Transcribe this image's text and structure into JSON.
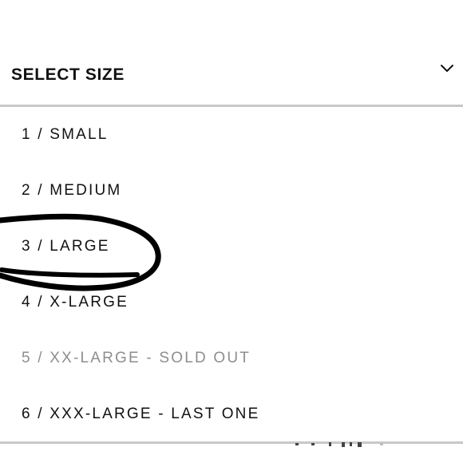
{
  "size_selector": {
    "title": "SELECT SIZE",
    "toggle_icon": "chevron-down-icon",
    "options": [
      {
        "label": "1 / SMALL",
        "available": true
      },
      {
        "label": "2 / MEDIUM",
        "available": true
      },
      {
        "label": "3 / LARGE",
        "available": true
      },
      {
        "label": "4 / X-LARGE",
        "available": true
      },
      {
        "label": "5 / XX-LARGE - SOLD OUT",
        "available": false
      },
      {
        "label": "6 / XXX-LARGE - LAST ONE",
        "available": true
      }
    ]
  },
  "colors": {
    "text": "#111111",
    "sold_out_text": "#8e8e8e",
    "divider": "#c8c8c8",
    "scribble": "#000000"
  }
}
